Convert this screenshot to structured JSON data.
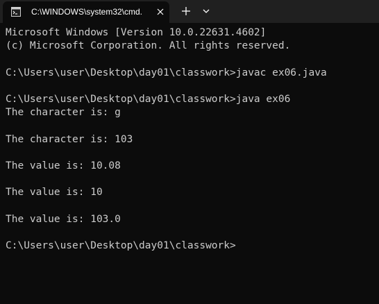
{
  "tab": {
    "title": "C:\\WINDOWS\\system32\\cmd.",
    "icon": "cmd-icon"
  },
  "console": {
    "lines": [
      "Microsoft Windows [Version 10.0.22631.4602]",
      "(c) Microsoft Corporation. All rights reserved.",
      "",
      "C:\\Users\\user\\Desktop\\day01\\classwork>javac ex06.java",
      "",
      "C:\\Users\\user\\Desktop\\day01\\classwork>java ex06",
      "The character is: g",
      "",
      "The character is: 103",
      "",
      "The value is: 10.08",
      "",
      "The value is: 10",
      "",
      "The value is: 103.0",
      "",
      "C:\\Users\\user\\Desktop\\day01\\classwork>"
    ]
  },
  "colors": {
    "console_bg": "#0c0c0c",
    "console_fg": "#cccccc",
    "titlebar_bg": "#202020"
  }
}
